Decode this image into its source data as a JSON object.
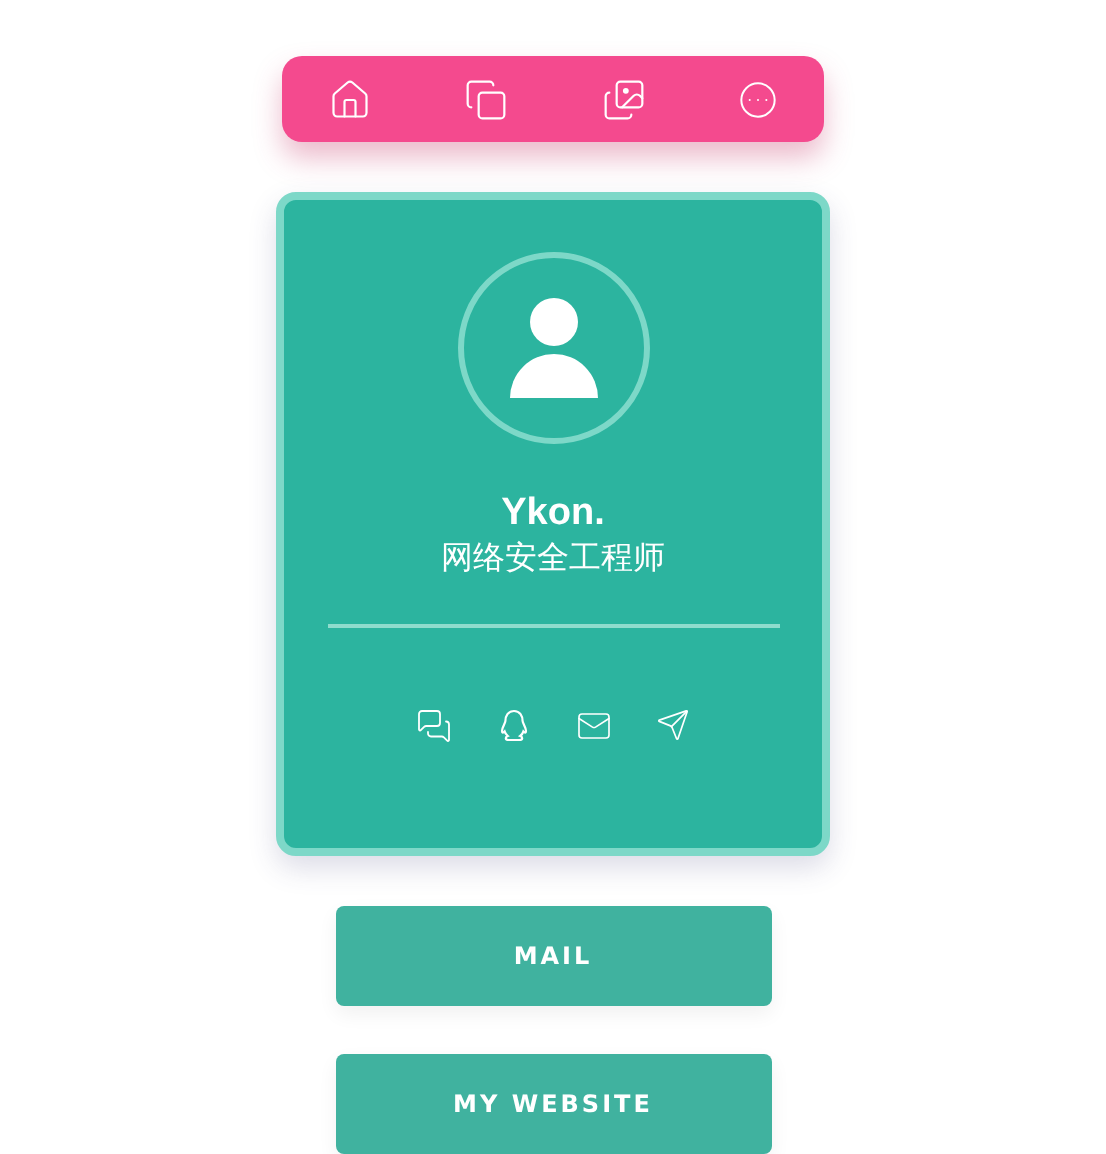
{
  "profile": {
    "name": "Ykon.",
    "role": "网络安全工程师"
  },
  "buttons": [
    "MAIL",
    "MY WEBSITE"
  ]
}
